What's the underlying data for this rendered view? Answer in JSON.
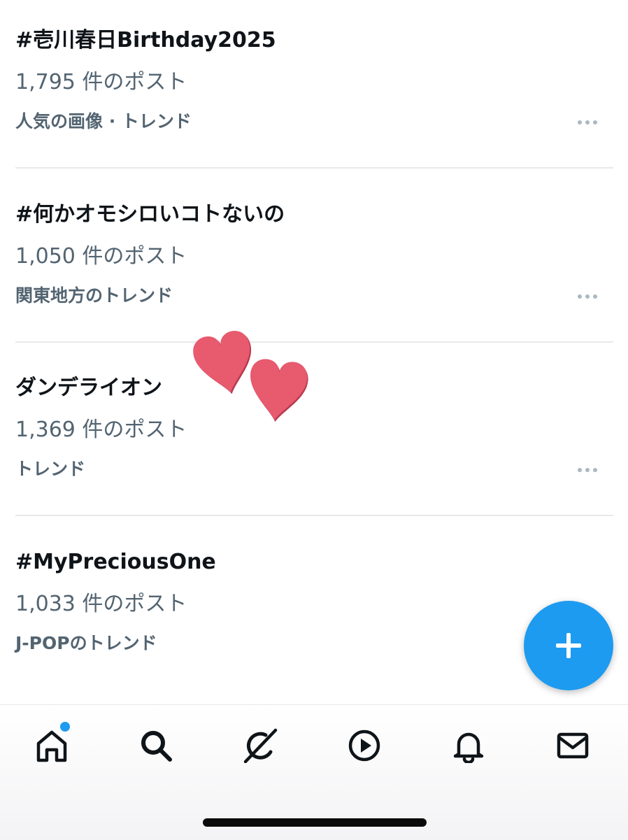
{
  "trends": [
    {
      "title": "#壱川春日Birthday2025",
      "post_count": "1,795 件のポスト",
      "context": "人気の画像 · トレンド",
      "more_icon": "more-dots-icon"
    },
    {
      "title": "#何かオモシロいコトないの",
      "post_count": "1,050 件のポスト",
      "context": "関東地方のトレンド",
      "more_icon": "more-dots-icon"
    },
    {
      "title": "ダンデライオン",
      "post_count": "1,369 件のポスト",
      "context": "トレンド",
      "more_icon": "more-dots-icon"
    },
    {
      "title": "#MyPreciousOne",
      "post_count": "1,033 件のポスト",
      "context": "J-POPのトレンド"
    }
  ],
  "compose_button": {
    "icon": "plus-icon",
    "color": "#1d9bf0"
  },
  "sticker": {
    "icon": "hearts-sticker",
    "color": "#e85a6e"
  },
  "tab_bar": {
    "tabs": [
      {
        "icon": "home-icon",
        "has_badge": true
      },
      {
        "icon": "search-icon"
      },
      {
        "icon": "grok-icon"
      },
      {
        "icon": "video-play-icon"
      },
      {
        "icon": "bell-icon"
      },
      {
        "icon": "mail-icon"
      }
    ],
    "badge_color": "#1d9bf0"
  }
}
